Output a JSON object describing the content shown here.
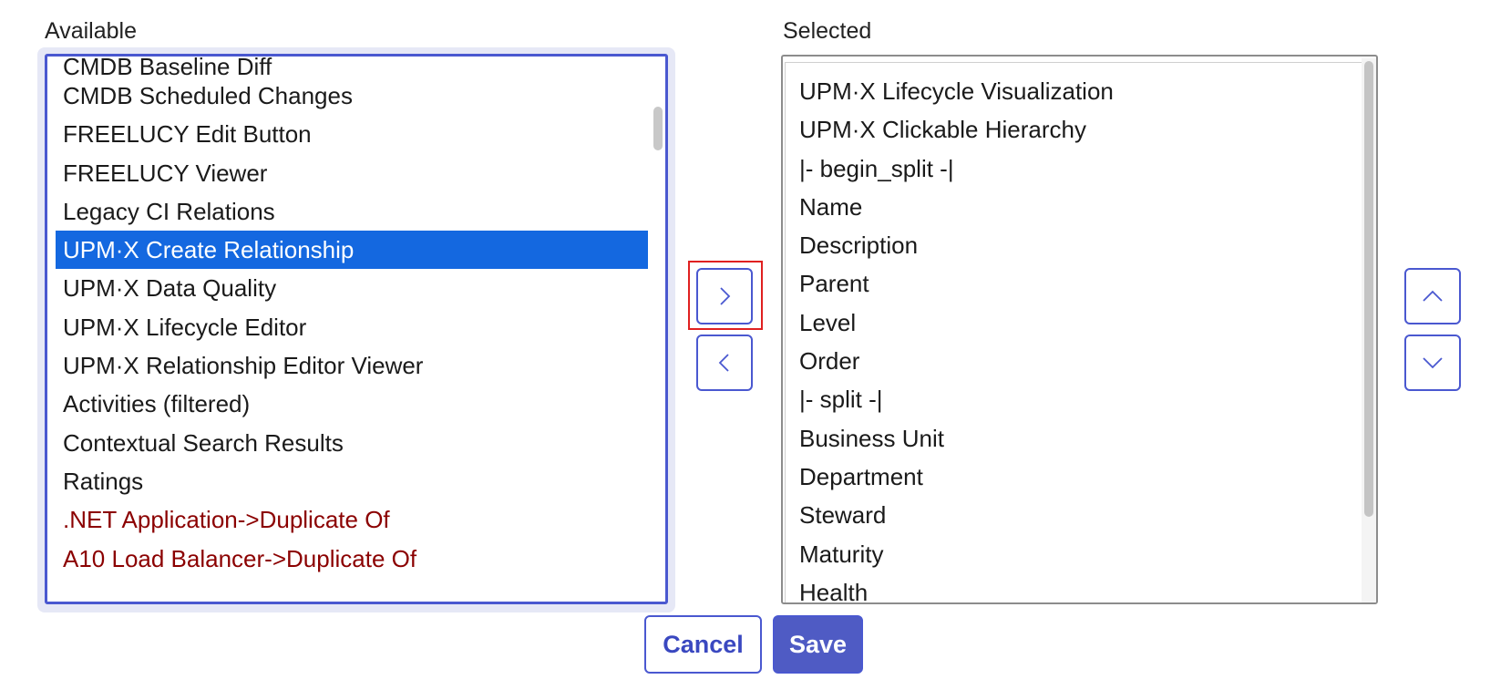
{
  "available": {
    "label": "Available",
    "items": [
      {
        "label": "CMDB Baseline Diff"
      },
      {
        "label": "CMDB Scheduled Changes"
      },
      {
        "label": "FREELUCY Edit Button"
      },
      {
        "label": "FREELUCY Viewer"
      },
      {
        "label": "Legacy CI Relations"
      },
      {
        "label": "UPM·X Create Relationship",
        "selected": true
      },
      {
        "label": "UPM·X Data Quality"
      },
      {
        "label": "UPM·X Lifecycle Editor"
      },
      {
        "label": "UPM·X Relationship Editor Viewer"
      },
      {
        "label": "Activities (filtered)"
      },
      {
        "label": "Contextual Search Results"
      },
      {
        "label": "Ratings"
      },
      {
        "label": ".NET Application->Duplicate Of",
        "color": "#8b0000"
      },
      {
        "label": "A10 Load Balancer->Duplicate Of",
        "color": "#8b0000"
      }
    ]
  },
  "selected": {
    "label": "Selected",
    "items": [
      {
        "label": "UPM·X Lifecycle Visualization"
      },
      {
        "label": "UPM·X Clickable Hierarchy"
      },
      {
        "label": "|- begin_split -|"
      },
      {
        "label": "Name"
      },
      {
        "label": "Description"
      },
      {
        "label": "Parent"
      },
      {
        "label": "Level"
      },
      {
        "label": "Order"
      },
      {
        "label": "|- split -|"
      },
      {
        "label": "Business Unit"
      },
      {
        "label": "Department"
      },
      {
        "label": "Steward"
      },
      {
        "label": "Maturity"
      },
      {
        "label": "Health"
      }
    ]
  },
  "buttons": {
    "add_icon": "chevron-right-icon",
    "remove_icon": "chevron-left-icon",
    "move_up_icon": "chevron-up-icon",
    "move_down_icon": "chevron-down-icon",
    "cancel": "Cancel",
    "save": "Save"
  },
  "colors": {
    "accent": "#4a58d0",
    "selection": "#1468e0",
    "save_bg": "#4f5bc4",
    "relationship_item": "#8b0000"
  }
}
